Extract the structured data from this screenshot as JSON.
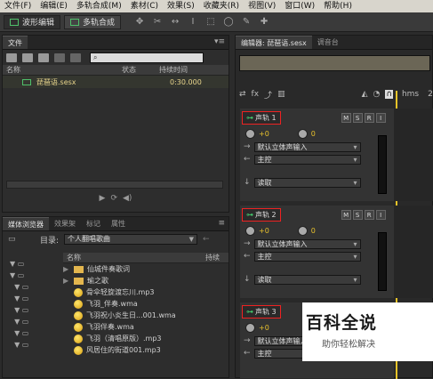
{
  "menu": [
    "文件(F)",
    "编辑(E)",
    "多轨合成(M)",
    "素材(C)",
    "效果(S)",
    "收藏夹(R)",
    "视图(V)",
    "窗口(W)",
    "帮助(H)"
  ],
  "toolbar": {
    "waveform_label": "波形编辑",
    "multitrack_label": "多轨合成"
  },
  "files_panel": {
    "tab": "文件",
    "search_placeholder": "",
    "columns": {
      "name": "名称",
      "status": "状态",
      "duration": "持续时间"
    },
    "files": [
      {
        "name": "琵琶语.sesx",
        "duration": "0:30.000"
      }
    ]
  },
  "editor": {
    "tab": "编辑器: 琵琶语.sesx",
    "tab2": "调音台",
    "ruler_label": "hms",
    "ruler_tick": "2."
  },
  "browser": {
    "tabs": [
      "媒体浏览器",
      "效果架",
      "标记",
      "属性"
    ],
    "dir_label": "目录:",
    "dir_value": "个人翻唱歌曲",
    "col_name": "名称",
    "col_duration": "持续",
    "items": [
      {
        "type": "folder",
        "name": "仙城件奏歌词"
      },
      {
        "type": "folder",
        "name": "瑜之歌"
      },
      {
        "type": "file",
        "name": "骨伞轻旋渡忘川.mp3"
      },
      {
        "type": "file",
        "name": "飞羽_伴奏.wma"
      },
      {
        "type": "file",
        "name": "飞羽祝小炎生日...001.wma"
      },
      {
        "type": "file",
        "name": "飞羽伴奏.wma"
      },
      {
        "type": "file",
        "name": "飞羽（清唱原版）.mp3"
      },
      {
        "type": "file",
        "name": "风居住的街道001.mp3"
      }
    ]
  },
  "tracks": [
    {
      "name": "声轨 1",
      "volume": "+0",
      "pan": "0",
      "input": "默认立体声输入",
      "output": "主控",
      "mode": "读取"
    },
    {
      "name": "声轨 2",
      "volume": "+0",
      "pan": "0",
      "input": "默认立体声输入",
      "output": "主控",
      "mode": "读取"
    },
    {
      "name": "声轨 3",
      "volume": "+0",
      "pan": "",
      "input": "默认立体声输入",
      "output": "主控",
      "mode": ""
    }
  ],
  "track_buttons": [
    "M",
    "S",
    "R",
    "I"
  ],
  "watermark": {
    "title": "百科全说",
    "subtitle": "助你轻松解决"
  }
}
